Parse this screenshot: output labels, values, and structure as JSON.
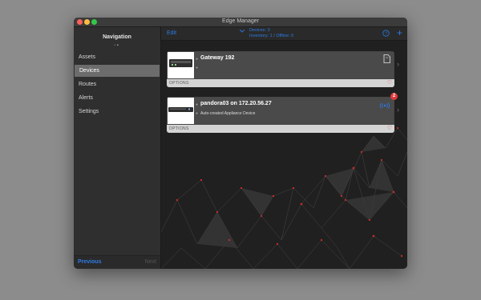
{
  "window": {
    "title": "Edge Manager"
  },
  "sidebar": {
    "title": "Navigation",
    "page_dots": [
      "•",
      "•"
    ],
    "items": [
      {
        "label": "Assets",
        "active": false
      },
      {
        "label": "Devices",
        "active": true
      },
      {
        "label": "Routes",
        "active": false
      },
      {
        "label": "Alerts",
        "active": false
      },
      {
        "label": "Settings",
        "active": false
      }
    ],
    "previous_label": "Previous",
    "next_label": "Next"
  },
  "toolbar": {
    "edit_label": "Edit",
    "status_line1": "Devices: 3",
    "status_line2": "Inventory: 1 / Offline: 0",
    "add_label": "+"
  },
  "devices": [
    {
      "name": "Gateway 192",
      "subtitle": "",
      "options_label": "OPTIONS",
      "status_icon": "document-icon",
      "badge": ""
    },
    {
      "name": "pandora03 on 172.20.56.27",
      "subtitle": "Auto-created Appliance Device",
      "options_label": "OPTIONS",
      "status_icon": "broadcast-icon",
      "badge": "2"
    }
  ],
  "colors": {
    "accent": "#2c7be5",
    "heart": "#e34a56",
    "badge": "#e0393c",
    "network_nodes": "#d42b2b"
  }
}
